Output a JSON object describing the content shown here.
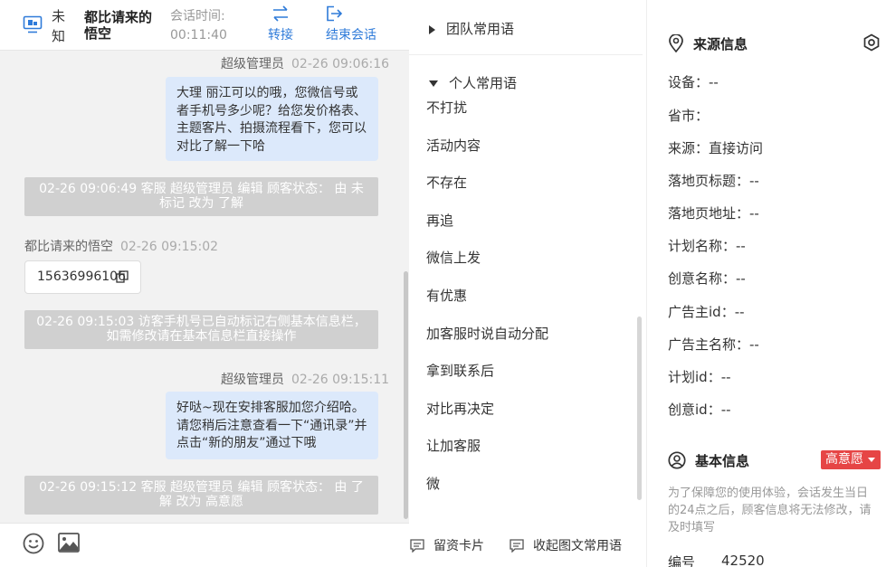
{
  "header": {
    "visitor_tag": "未知",
    "visitor_name": "都比请来的悟空",
    "session_label": "会话时间:",
    "session_time": "00:11:40",
    "transfer_label": "转接",
    "end_label": "结束会话"
  },
  "messages": {
    "m1_sender": "超级管理员",
    "m1_time": "02-26 09:06:16",
    "m1_text": "大理 丽江可以的哦，您微信号或者手机号多少呢？给您发价格表、主题客片、拍摄流程看下，您可以对比了解一下哈",
    "s1_text": "02-26 09:06:49 客服 超级管理员 编辑 顾客状态： 由 未标记 改为 了解",
    "m2_sender": "都比请来的悟空",
    "m2_time": "02-26 09:15:02",
    "m2_phone": "15636996106",
    "s2_text": "02-26 09:15:03 访客手机号已自动标记右侧基本信息栏，如需修改请在基本信息栏直接操作",
    "m3_sender": "超级管理员",
    "m3_time": "02-26 09:15:11",
    "m3_text": "好哒~现在安排客服加您介绍哈。请您稍后注意查看一下“通讯录”并点击“新的朋友”通过下哦",
    "s3_text": "02-26 09:15:12 客服 超级管理员 编辑 顾客状态： 由 了解 改为 高意愿"
  },
  "phrases": {
    "team_group": "团队常用语",
    "personal_group": "个人常用语",
    "items": [
      "不打扰",
      "活动内容",
      "不存在",
      "再追",
      "微信上发",
      "有优惠",
      "加客服时说自动分配",
      "拿到联系后",
      "对比再决定",
      "让加客服",
      "微"
    ],
    "footer_card": "留资卡片",
    "footer_collapse": "收起图文常用语"
  },
  "source_info": {
    "title": "来源信息",
    "fields": [
      "设备：--",
      "省市：",
      "来源：直接访问",
      "落地页标题：--",
      "落地页地址：--",
      "计划名称：--",
      "创意名称：--",
      "广告主id：--",
      "广告主名称：--",
      "计划id：--",
      "创意id：--"
    ]
  },
  "basic_info": {
    "title": "基本信息",
    "badge": "高意愿",
    "notice": "为了保障您的使用体验，会话发生当日的24点之后，顾客信息将无法修改，请及时填写",
    "id_label": "编号",
    "id_value": "42520"
  },
  "colors": {
    "accent": "#2f7bd9",
    "bubble": "#dce9fb",
    "system": "#d0d0d0",
    "badge": "#e64545"
  }
}
